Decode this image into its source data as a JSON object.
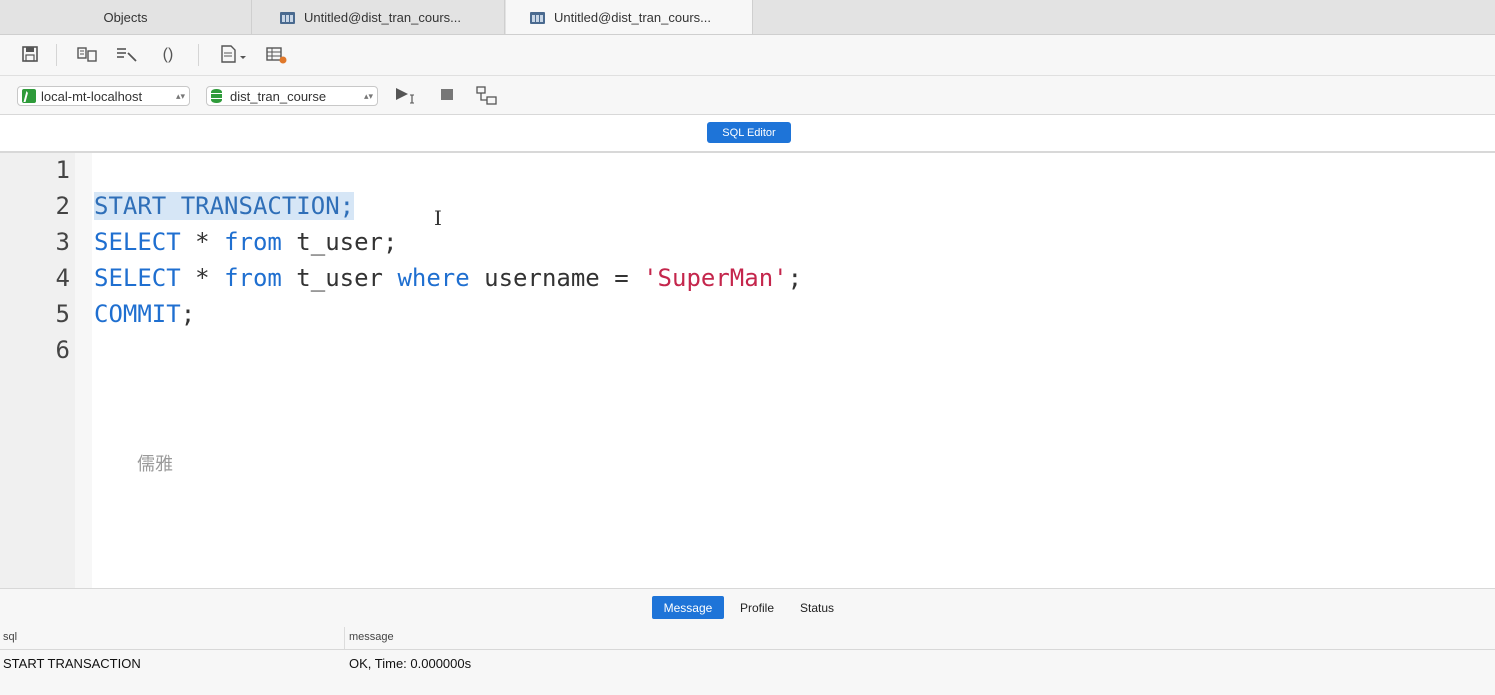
{
  "tabs": [
    {
      "label": "Objects"
    },
    {
      "label": "Untitled@dist_tran_cours..."
    },
    {
      "label": "Untitled@dist_tran_cours..."
    }
  ],
  "toolbar": {
    "icons": [
      "save-icon",
      "format-icon",
      "explain-icon",
      "brackets-icon",
      "file-icon",
      "snippet-icon"
    ],
    "brackets_glyph": "()"
  },
  "connection": {
    "selected": "local-mt-localhost"
  },
  "database": {
    "selected": "dist_tran_course"
  },
  "editor_label": "SQL Editor",
  "editor": {
    "line_numbers": [
      "1",
      "2",
      "3",
      "4",
      "5",
      "6"
    ],
    "lines": [
      {
        "tokens": []
      },
      {
        "tokens": [
          {
            "t": "START TRANSACTION;",
            "c": "kw-sel"
          }
        ]
      },
      {
        "tokens": [
          {
            "t": "SELECT",
            "c": "kw"
          },
          {
            "t": " * ",
            "c": ""
          },
          {
            "t": "from",
            "c": "kw"
          },
          {
            "t": " t_user;",
            "c": ""
          }
        ]
      },
      {
        "tokens": [
          {
            "t": "SELECT",
            "c": "kw"
          },
          {
            "t": " * ",
            "c": ""
          },
          {
            "t": "from",
            "c": "kw"
          },
          {
            "t": " t_user ",
            "c": ""
          },
          {
            "t": "where",
            "c": "kw"
          },
          {
            "t": " username = ",
            "c": ""
          },
          {
            "t": "'SuperMan'",
            "c": "str"
          },
          {
            "t": ";",
            "c": ""
          }
        ]
      },
      {
        "tokens": [
          {
            "t": "COMMIT",
            "c": "kw"
          },
          {
            "t": ";",
            "c": ""
          }
        ]
      },
      {
        "tokens": []
      }
    ],
    "overlay_text": "儒雅"
  },
  "result": {
    "tabs": [
      {
        "label": "Message",
        "active": true
      },
      {
        "label": "Profile",
        "active": false
      },
      {
        "label": "Status",
        "active": false
      }
    ],
    "columns": [
      "sql",
      "message"
    ],
    "rows": [
      [
        "START TRANSACTION",
        "OK, Time: 0.000000s"
      ]
    ]
  },
  "colors": {
    "accent": "#1e74d8",
    "keyword": "#1f6fd0",
    "string": "#c4264c",
    "selection": "#d6e6f6"
  }
}
